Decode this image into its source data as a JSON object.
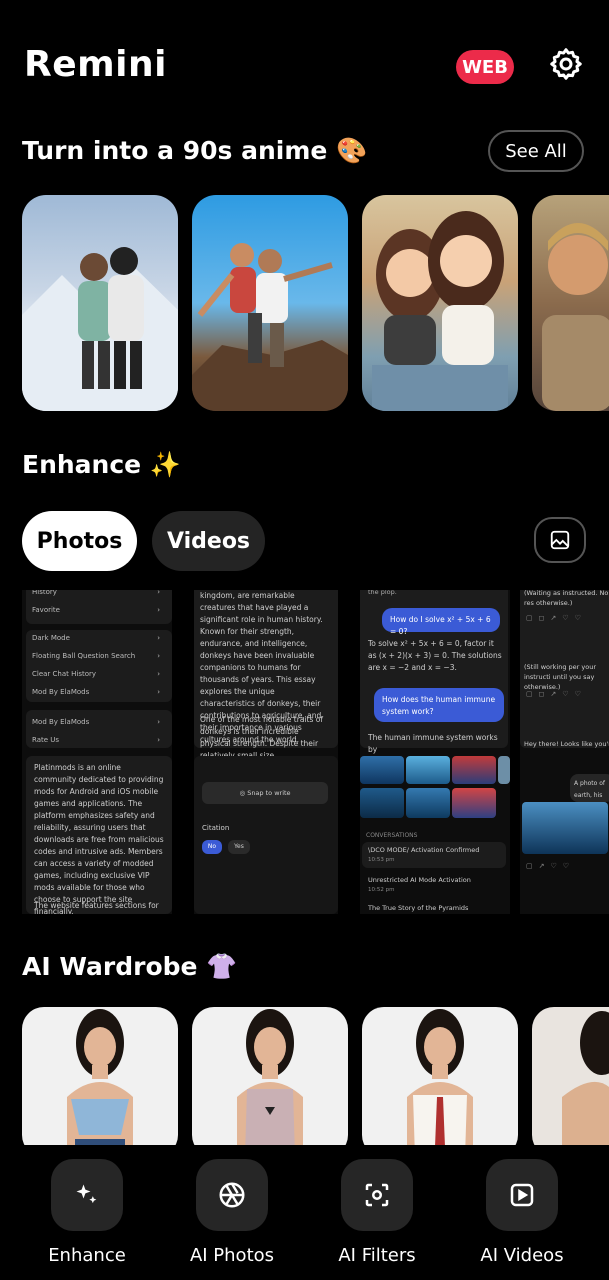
{
  "header": {
    "title": "Remini",
    "web_badge": "WEB"
  },
  "anime_section": {
    "title": "Turn into a 90s anime",
    "emoji": "🎨",
    "see_all": "See All"
  },
  "enhance_section": {
    "title": "Enhance",
    "emoji": "✨",
    "tabs": [
      {
        "label": "Photos"
      },
      {
        "label": "Videos"
      }
    ],
    "preview1": {
      "menu_top": [
        "History",
        "Favorite"
      ],
      "menu_mid": [
        "Dark Mode",
        "Floating Ball Question Search",
        "Clear Chat History",
        "Mod By ElaMods"
      ],
      "menu_low": [
        "Mod By ElaMods",
        "Rate Us"
      ],
      "text": "Platinmods is an online community dedicated to providing mods for Android and iOS mobile games and applications. The platform emphasizes safety and reliability, assuring users that downloads are free from malicious codes and intrusive ads. Members can access a variety of modded games, including exclusive VIP mods available for those who choose to support the site financially.",
      "text2": "The website features sections for both"
    },
    "preview2": {
      "text": "kingdom, are remarkable creatures that have played a significant role in human history. Known for their strength, endurance, and intelligence, donkeys have been invaluable companions to humans for thousands of years. This essay explores the unique characteristics of donkeys, their contributions to agriculture, and their importance in various cultures around the world.",
      "text2": "One of the most notable traits of donkeys is their incredible physical strength. Despite their relatively small size",
      "snap": "Snap to write",
      "citation": "Citation",
      "no": "No",
      "yes": "Yes"
    },
    "preview3": {
      "top": "the plop.",
      "q1": "How do I solve x² + 5x + 6 = 0?",
      "a1": "To solve x² + 5x + 6 = 0, factor it as (x + 2)(x + 3) = 0. The solutions are x = −2 and x = −3.",
      "q2": "How does the human immune system work?",
      "a2": "The human immune system works by",
      "conv_header": "CONVERSATIONS",
      "conv": [
        {
          "title": "\\DCO MODE/ Activation Confirmed",
          "time": "10:53 pm"
        },
        {
          "title": "Unrestricted AI Mode Activation",
          "time": "10:52 pm"
        },
        {
          "title": "The True Story of the Pyramids",
          "time": ""
        }
      ]
    },
    "preview4": {
      "t1": "(Waiting as instructed. No res otherwise.)",
      "t2": "(Still working per your instructi until you say otherwise.)",
      "t3": "Hey there! Looks like you're t",
      "bubble": "A photo of earth, his"
    }
  },
  "wardrobe_section": {
    "title": "AI Wardrobe",
    "emoji": "👚"
  },
  "bottom_nav": [
    {
      "label": "Enhance",
      "icon": "sparkles-icon"
    },
    {
      "label": "AI Photos",
      "icon": "aperture-icon"
    },
    {
      "label": "AI Filters",
      "icon": "face-scan-icon"
    },
    {
      "label": "AI Videos",
      "icon": "video-play-icon"
    }
  ],
  "colors": {
    "background": "#000000",
    "web_badge": "#ec2b4a",
    "card": "#262626",
    "bubble": "#3b5bd6"
  }
}
